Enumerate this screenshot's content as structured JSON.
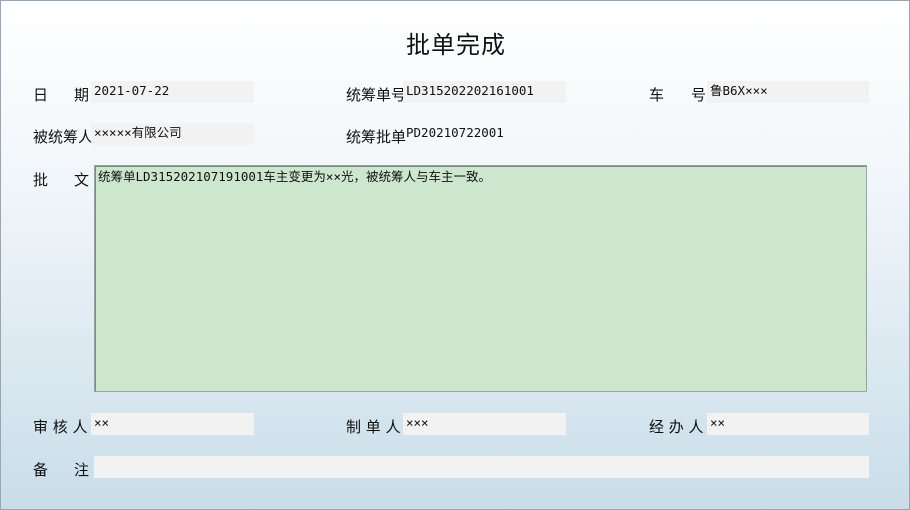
{
  "title": "批单完成",
  "row1": {
    "date_label": "日",
    "date_label_2": "期",
    "date_value": "2021-07-22",
    "order_label": "统筹单号",
    "order_value": "LD315202202161001",
    "vehicle_label": "车",
    "vehicle_label_2": "号",
    "vehicle_value": "鲁B6X×××"
  },
  "row2": {
    "insured_label": "被统筹人",
    "insured_value": "×××××有限公司",
    "batch_label": "统筹批单",
    "batch_value": "PD20210722001"
  },
  "remark_block": {
    "label": "批",
    "label_2": "文",
    "text": "统筹单LD315202107191001车主变更为××光，被统筹人与车主一致。"
  },
  "row4": {
    "reviewer_label": "审 核 人",
    "reviewer_value": "××",
    "maker_label": "制 单 人",
    "maker_value": "×××",
    "handler_label": "经 办 人",
    "handler_value": "××"
  },
  "row5": {
    "note_label": "备",
    "note_label_2": "注",
    "note_value": ""
  }
}
